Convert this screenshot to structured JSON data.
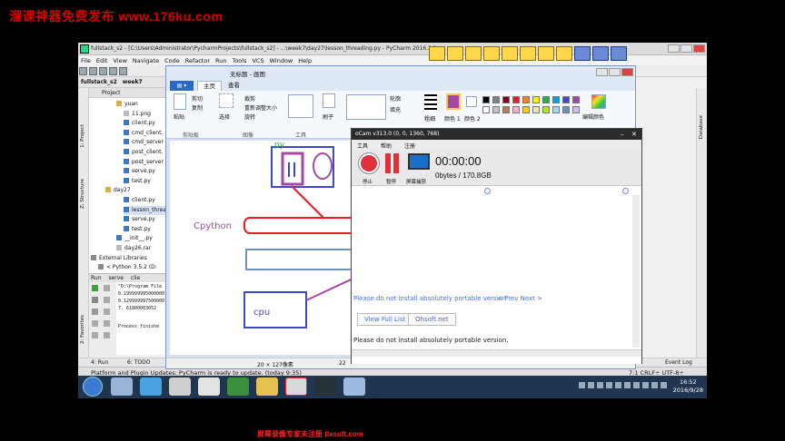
{
  "watermark": {
    "top": "溜课神器免费发布 www.176ku.com",
    "bottom": "屏幕录像专家未注册 tlxsoft.com"
  },
  "pycharm": {
    "title": "fullstack_s2 - [C:\\Users\\Administrator\\PycharmProjects\\fullstack_s2] - ...\\week7\\day27\\lesson_threading.py - PyCharm 2016.2.1",
    "menu": [
      "File",
      "Edit",
      "View",
      "Navigate",
      "Code",
      "Refactor",
      "Run",
      "Tools",
      "VCS",
      "Window",
      "Help"
    ],
    "nav": [
      "fullstack_s2",
      "week7"
    ],
    "project_label": "Project",
    "tree": [
      {
        "label": "yuan",
        "type": "folder"
      },
      {
        "label": "11.png",
        "type": "file"
      },
      {
        "label": "client.py",
        "type": "py"
      },
      {
        "label": "cmd_client.",
        "type": "py"
      },
      {
        "label": "cmd_server",
        "type": "py"
      },
      {
        "label": "post_client.",
        "type": "py"
      },
      {
        "label": "post_server",
        "type": "py"
      },
      {
        "label": "serve.py",
        "type": "py"
      },
      {
        "label": "test.py",
        "type": "py"
      },
      {
        "label": "day27",
        "type": "folder"
      },
      {
        "label": "client.py",
        "type": "py"
      },
      {
        "label": "lesson_threa",
        "type": "py"
      },
      {
        "label": "serve.py",
        "type": "py"
      },
      {
        "label": "test.py",
        "type": "py"
      },
      {
        "label": "__init__.py",
        "type": "py"
      },
      {
        "label": "day26.rar",
        "type": "file"
      },
      {
        "label": "External Libraries",
        "type": "lib"
      },
      {
        "label": "< Python 3.5.2 (D:",
        "type": "lib"
      }
    ],
    "run_label": "Run",
    "run_tabs": [
      "serve",
      "clie"
    ],
    "console": [
      "\"D:\\Program File",
      "0.199999995000000",
      "0.129999997500000",
      "7. 61800003052",
      "Process finishe"
    ],
    "left_vtabs": [
      "1: Project",
      "Z: Structure",
      "2: Favorites"
    ],
    "right_vtabs": [
      "Database"
    ],
    "bottom_tabs": [
      "4: Run",
      "6: TODO",
      "Event Log"
    ],
    "status_msg": "Platform and Plugin Updates: PyCharm is ready to update. (today 9:35)",
    "status_right": "7:1  CRLF÷  UTF-8÷"
  },
  "paint": {
    "title": "无标题 - 画图",
    "tabs": [
      "主页",
      "查看"
    ],
    "groups": [
      "剪贴板",
      "图像",
      "工具",
      "形状",
      "颜色"
    ],
    "clip": {
      "paste": "粘贴",
      "cut": "剪切",
      "copy": "复制"
    },
    "image": {
      "select": "选择",
      "crop": "裁剪",
      "resize": "重新调整大小",
      "rotate": "旋转"
    },
    "brushes": "刷子",
    "shapes": {
      "outline": "轮廓",
      "fill": "填充"
    },
    "colors": {
      "size": "粗细",
      "color1": "颜色 1",
      "color2": "颜色 2",
      "edit": "编辑颜色"
    },
    "swatches": [
      "#000000",
      "#7f7f7f",
      "#880015",
      "#ed1c24",
      "#ff7f27",
      "#fff200",
      "#22b14c",
      "#00a2e8",
      "#3f48cc",
      "#a349a4",
      "#ffffff",
      "#c3c3c3",
      "#b97a57",
      "#ffaec9",
      "#ffc90e",
      "#efe4b0",
      "#b5e61d",
      "#99d9ea",
      "#7092be",
      "#c8bfe7"
    ],
    "canvas_labels": {
      "py": ".py",
      "cpython": "Cpython",
      "cpu": "cpu"
    },
    "status": {
      "size": "20 × 127像素",
      "partial": "22"
    }
  },
  "ocam": {
    "title": "oCam v313.0 (0, 0, 1360, 768)",
    "menu": [
      "工具",
      "帮助",
      "注册"
    ],
    "buttons": [
      "停止",
      "暂停",
      "屏幕捕获"
    ],
    "timer": "00:00:00",
    "size": "0bytes / 170.8GB",
    "notice": "Please do not install absolutely portable version",
    "prev_next": "< Prev Next >",
    "btn_full": "View Full List",
    "btn_site": "Ohsoft.net",
    "footer": "Please do not install absolutely portable version."
  },
  "taskbar": {
    "time": "16:52",
    "date": "2016/9/28"
  },
  "colors": {
    "accent_blue": "#3f48cc",
    "accent_red": "#e0303a",
    "paint_file_tab": "#2b67c6"
  }
}
